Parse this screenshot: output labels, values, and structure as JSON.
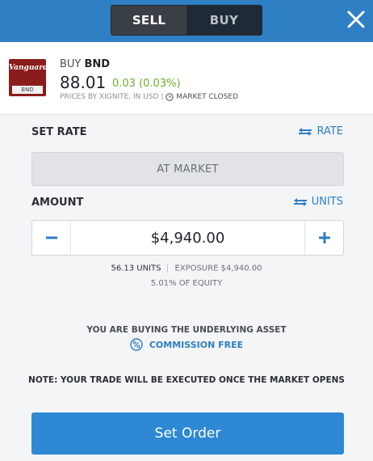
{
  "tabs": {
    "sell": "SELL",
    "buy": "BUY"
  },
  "instrument": {
    "logo_top": "Vanguard",
    "logo_bottom": "BND",
    "action": "BUY",
    "symbol": "BND",
    "price": "88.01",
    "change": "0.03 (0.03%)",
    "source": "PRICES BY XIGNITE, IN USD |",
    "market_status": "MARKET CLOSED"
  },
  "set_rate": {
    "label": "SET RATE",
    "toggle": "RATE",
    "market_button": "AT MARKET"
  },
  "amount": {
    "label": "AMOUNT",
    "toggle": "UNITS",
    "value": "$4,940.00",
    "units": "56.13 UNITS",
    "exposure": "EXPOSURE $4,940.00",
    "equity": "5.01% OF EQUITY"
  },
  "notice": {
    "underlying": "YOU ARE BUYING THE UNDERLYING ASSET",
    "commission": "COMMISSION FREE",
    "note": "NOTE: YOUR TRADE WILL BE EXECUTED ONCE THE MARKET OPENS"
  },
  "submit": {
    "label": "Set Order"
  },
  "colors": {
    "accent": "#2e7fc4",
    "change_positive": "#6fae2a",
    "logo_red": "#8b1c1c"
  }
}
